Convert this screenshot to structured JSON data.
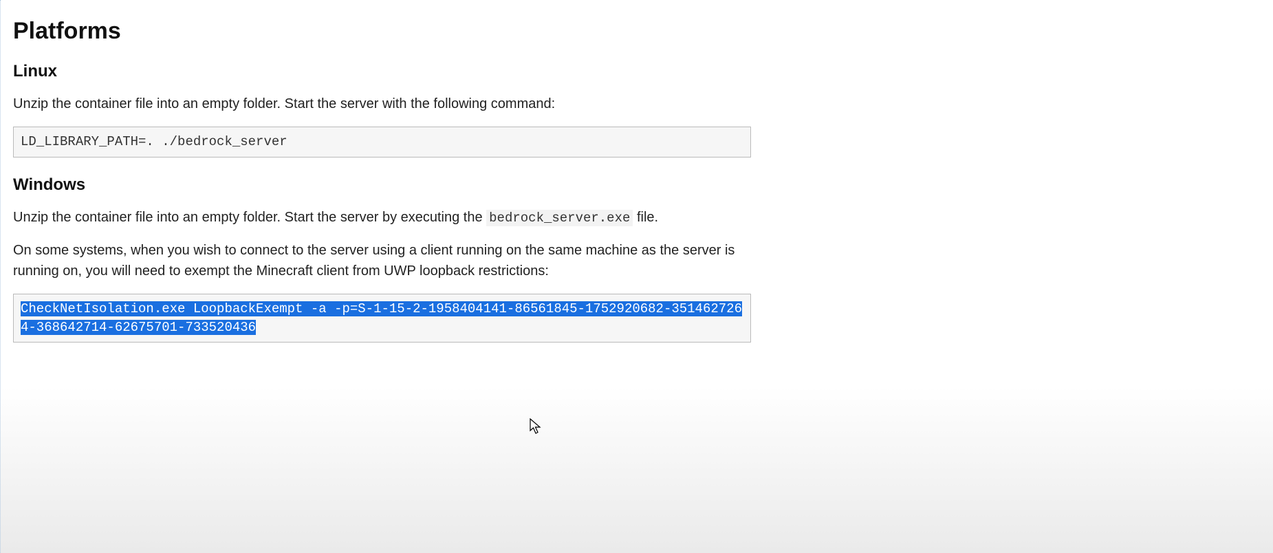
{
  "document": {
    "title": "Platforms",
    "sections": {
      "linux": {
        "heading": "Linux",
        "intro": "Unzip the container file into an empty folder. Start the server with the following command:",
        "command": "LD_LIBRARY_PATH=. ./bedrock_server"
      },
      "windows": {
        "heading": "Windows",
        "intro_pre": "Unzip the container file into an empty folder. Start the server by executing the ",
        "exe_name": "bedrock_server.exe",
        "intro_post": " file.",
        "loopback_note": "On some systems, when you wish to connect to the server using a client running on the same machine as the server is running on, you will need to exempt the Minecraft client from UWP loopback restrictions:",
        "command": "CheckNetIsolation.exe LoopbackExempt -a -p=S-1-15-2-1958404141-86561845-1752920682-3514627264-368642714-62675701-733520436",
        "command_selected": true
      }
    }
  }
}
